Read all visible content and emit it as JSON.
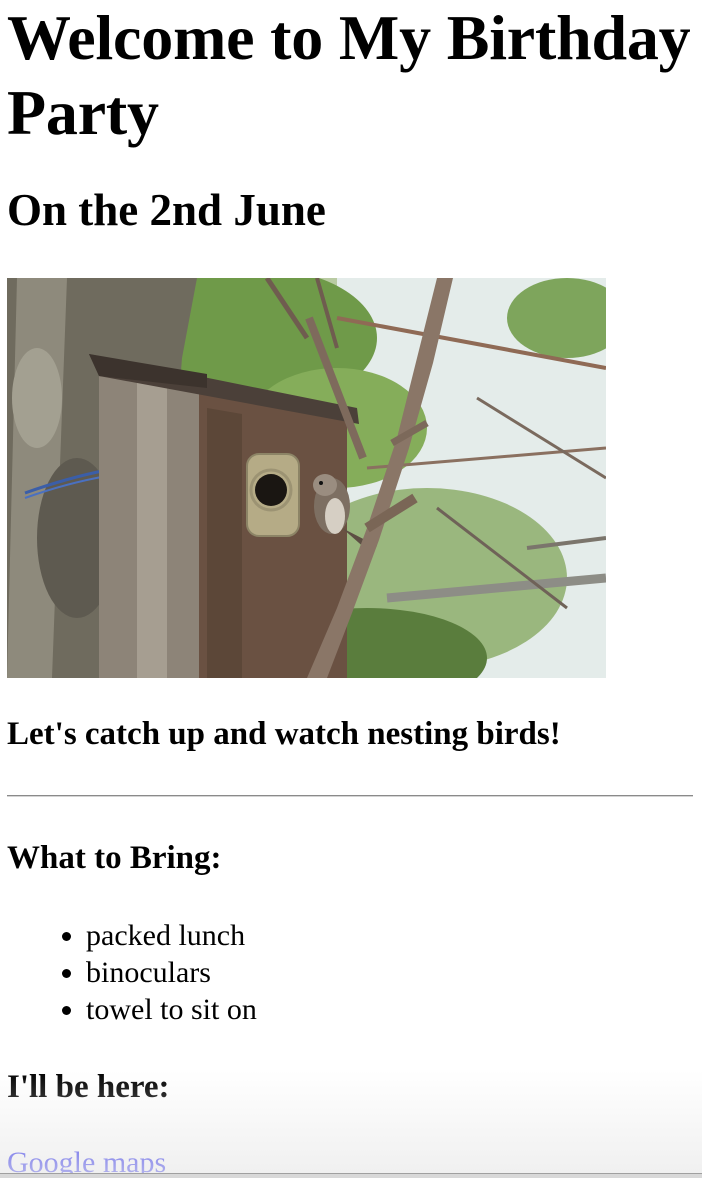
{
  "header": {
    "title": "Welcome to My Birthday Party",
    "subtitle": "On the 2nd June"
  },
  "image": {
    "subject": "bird-nest-box-photo"
  },
  "main": {
    "tagline": "Let's catch up and watch nesting birds!",
    "bring": {
      "heading": "What to Bring:",
      "items": [
        "packed lunch",
        "binoculars",
        "towel to sit on"
      ]
    },
    "location": {
      "heading": "I'll be here:",
      "link_label": "Google maps"
    }
  },
  "colors": {
    "link": "#0000ee",
    "text": "#000000",
    "background": "#ffffff"
  }
}
